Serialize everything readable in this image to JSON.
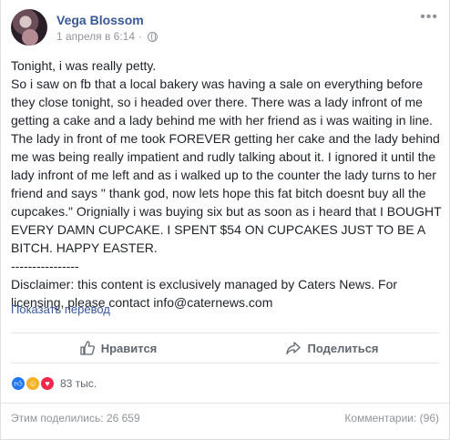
{
  "post": {
    "author": "Vega Blossom",
    "date": "1 апреля в 6:14",
    "separator": "·",
    "body": [
      "Tonight, i was really petty.",
      "So i saw on fb that a local bakery was having a sale on everything before they close tonight, so i headed over there. There was a lady infront of me getting a cake and a lady behind me with her friend as i was waiting in line. The lady in front of me took FOREVER getting her cake and the lady behind me was being really impatient and rudly talking about it. I ignored it until the lady infront of me left and as i walked up to the counter the lady turns to her friend and says \" thank god, now lets hope this fat bitch doesnt buy all the cupcakes.\" Orignially i was buying six but as soon as i heard that I BOUGHT EVERY DAMN CUPCAKE. I SPENT $54 ON CUPCAKES JUST TO BE A BITCH. HAPPY EASTER.",
      "----------------",
      "Disclaimer: this content is exclusively managed by Caters News. For licensing, please contact info@caternews.com"
    ],
    "see_translation": "Показать перевод"
  },
  "actions": {
    "like_label": "Нравится",
    "share_label": "Поделиться"
  },
  "reactions": {
    "count": "83 тыс."
  },
  "footer": {
    "shares": "Этим поделились: 26 659",
    "comments": "Комментарии: (96)"
  },
  "colors": {
    "link": "#385898",
    "like_reaction": "#2078f4",
    "haha_reaction": "#f7b125",
    "love_reaction": "#f0284a"
  }
}
